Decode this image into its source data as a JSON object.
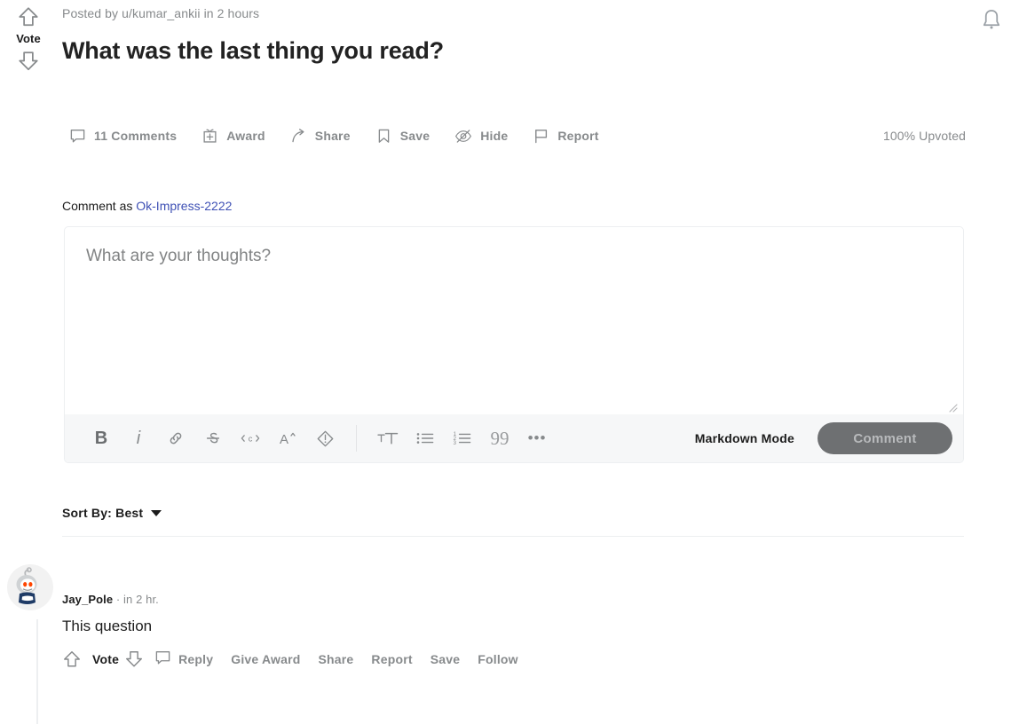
{
  "post": {
    "posted_by": "Posted by u/kumar_ankii in 2 hours",
    "title": "What was the last thing you read?",
    "vote_label": "Vote",
    "upvoted": "100% Upvoted"
  },
  "actions": [
    {
      "icon": "comment-bubble-icon",
      "label": "11 Comments"
    },
    {
      "icon": "award-gift-icon",
      "label": "Award"
    },
    {
      "icon": "share-arrow-icon",
      "label": "Share"
    },
    {
      "icon": "bookmark-save-icon",
      "label": "Save"
    },
    {
      "icon": "eye-slash-hide-icon",
      "label": "Hide"
    },
    {
      "icon": "flag-report-icon",
      "label": "Report"
    }
  ],
  "composer": {
    "comment_as_prefix": "Comment as ",
    "username": "Ok-Impress-2222",
    "placeholder": "What are your thoughts?",
    "value": "",
    "markdown_mode": "Markdown Mode",
    "submit_label": "Comment",
    "tools": [
      {
        "name": "bold-icon",
        "glyph": "B"
      },
      {
        "name": "italic-icon",
        "glyph": "i"
      },
      {
        "name": "link-icon",
        "glyph": "&"
      },
      {
        "name": "strikethrough-icon",
        "glyph": "S"
      },
      {
        "name": "inline-code-icon",
        "glyph": "<c>"
      },
      {
        "name": "superscript-icon",
        "glyph": "A^"
      },
      {
        "name": "spoiler-icon",
        "glyph": "!"
      },
      {
        "name": "heading-icon",
        "glyph": "TT"
      },
      {
        "name": "bulleted-list-icon",
        "glyph": "ul"
      },
      {
        "name": "numbered-list-icon",
        "glyph": "ol"
      },
      {
        "name": "quote-icon",
        "glyph": "99"
      },
      {
        "name": "more-options-icon",
        "glyph": "•••"
      }
    ]
  },
  "sort": {
    "label": "Sort By: Best"
  },
  "comment": {
    "author": "Jay_Pole",
    "separator": " · ",
    "time": "in 2 hr.",
    "text": "This question",
    "vote_label": "Vote",
    "actions": [
      "Reply",
      "Give Award",
      "Share",
      "Report",
      "Save",
      "Follow"
    ]
  },
  "colors": {
    "accent": "#3f51b5",
    "muted": "#878a8c",
    "text": "#1c1c1c",
    "toolbar_bg": "#f6f7f8",
    "border": "#edeff1",
    "submit_bg": "#6e7072"
  },
  "icons": {
    "bell": "notification-bell-icon",
    "upvote": "upvote-arrow-icon",
    "downvote": "downvote-arrow-icon",
    "avatar": "snoo-avatar-icon"
  }
}
